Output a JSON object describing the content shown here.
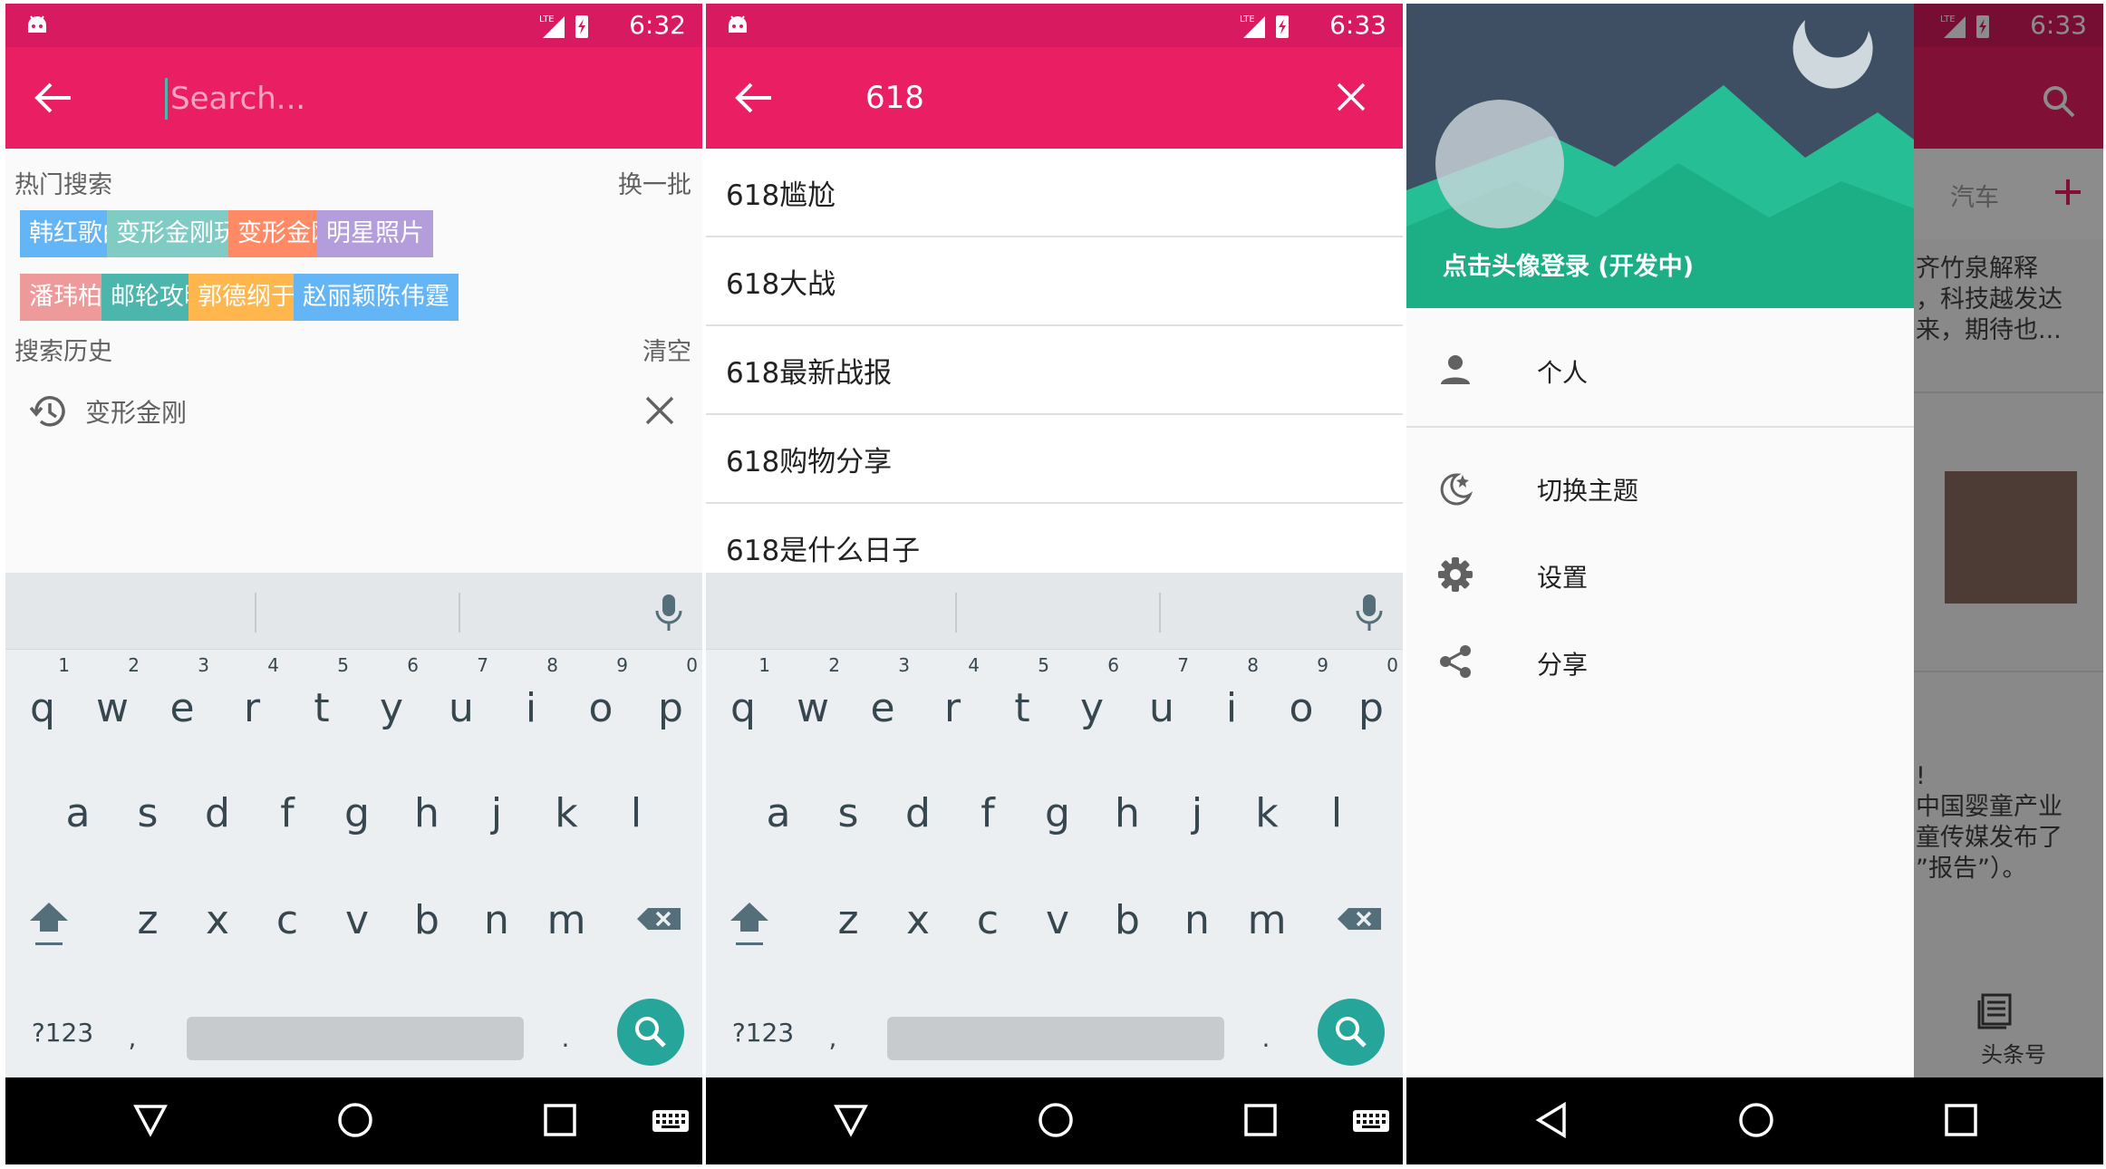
{
  "colors": {
    "primary": "#e91e63",
    "status_bar": "#d81b60",
    "accent": "#26a69a",
    "tag_colors": [
      "#64b5f6",
      "#80cbc4",
      "#ff8a65",
      "#b39ddb",
      "#ef9a9a",
      "#4db6ac",
      "#ffb74d",
      "#64b5f6"
    ]
  },
  "panel1": {
    "status_time": "6:32",
    "search_placeholder": "Search...",
    "hot_label": "热门搜索",
    "refresh_label": "换一批",
    "tags": [
      "韩红歌曲",
      "变形金刚玩具",
      "变形金刚",
      "明星照片",
      "潘玮柏",
      "邮轮攻略",
      "郭德纲于谦",
      "赵丽颖陈伟霆"
    ],
    "history_label": "搜索历史",
    "clear_label": "清空",
    "history": [
      "变形金刚"
    ]
  },
  "panel2": {
    "status_time": "6:33",
    "query": "618",
    "suggestions": [
      "618尴尬",
      "618大战",
      "618最新战报",
      "618购物分享",
      "618是什么日子"
    ]
  },
  "keyboard": {
    "row1": [
      "q",
      "w",
      "e",
      "r",
      "t",
      "y",
      "u",
      "i",
      "o",
      "p"
    ],
    "row1_nums": [
      "1",
      "2",
      "3",
      "4",
      "5",
      "6",
      "7",
      "8",
      "9",
      "0"
    ],
    "row2": [
      "a",
      "s",
      "d",
      "f",
      "g",
      "h",
      "j",
      "k",
      "l"
    ],
    "row3": [
      "z",
      "x",
      "c",
      "v",
      "b",
      "n",
      "m"
    ],
    "sym_label": "?123",
    "comma": ",",
    "period": "."
  },
  "panel3": {
    "status_time": "6:33",
    "login_text": "点击头像登录 (开发中)",
    "menu": [
      "个人",
      "切换主题",
      "设置",
      "分享"
    ],
    "bg_tab": "汽车",
    "bg_text1": [
      "齐竹泉解释",
      "，科技越发达",
      "来，期待也..."
    ],
    "bg_text2": [
      "!",
      "中国婴童产业",
      "童传媒发布了",
      "”报告”）。"
    ],
    "bg_nav_label": "头条号"
  }
}
